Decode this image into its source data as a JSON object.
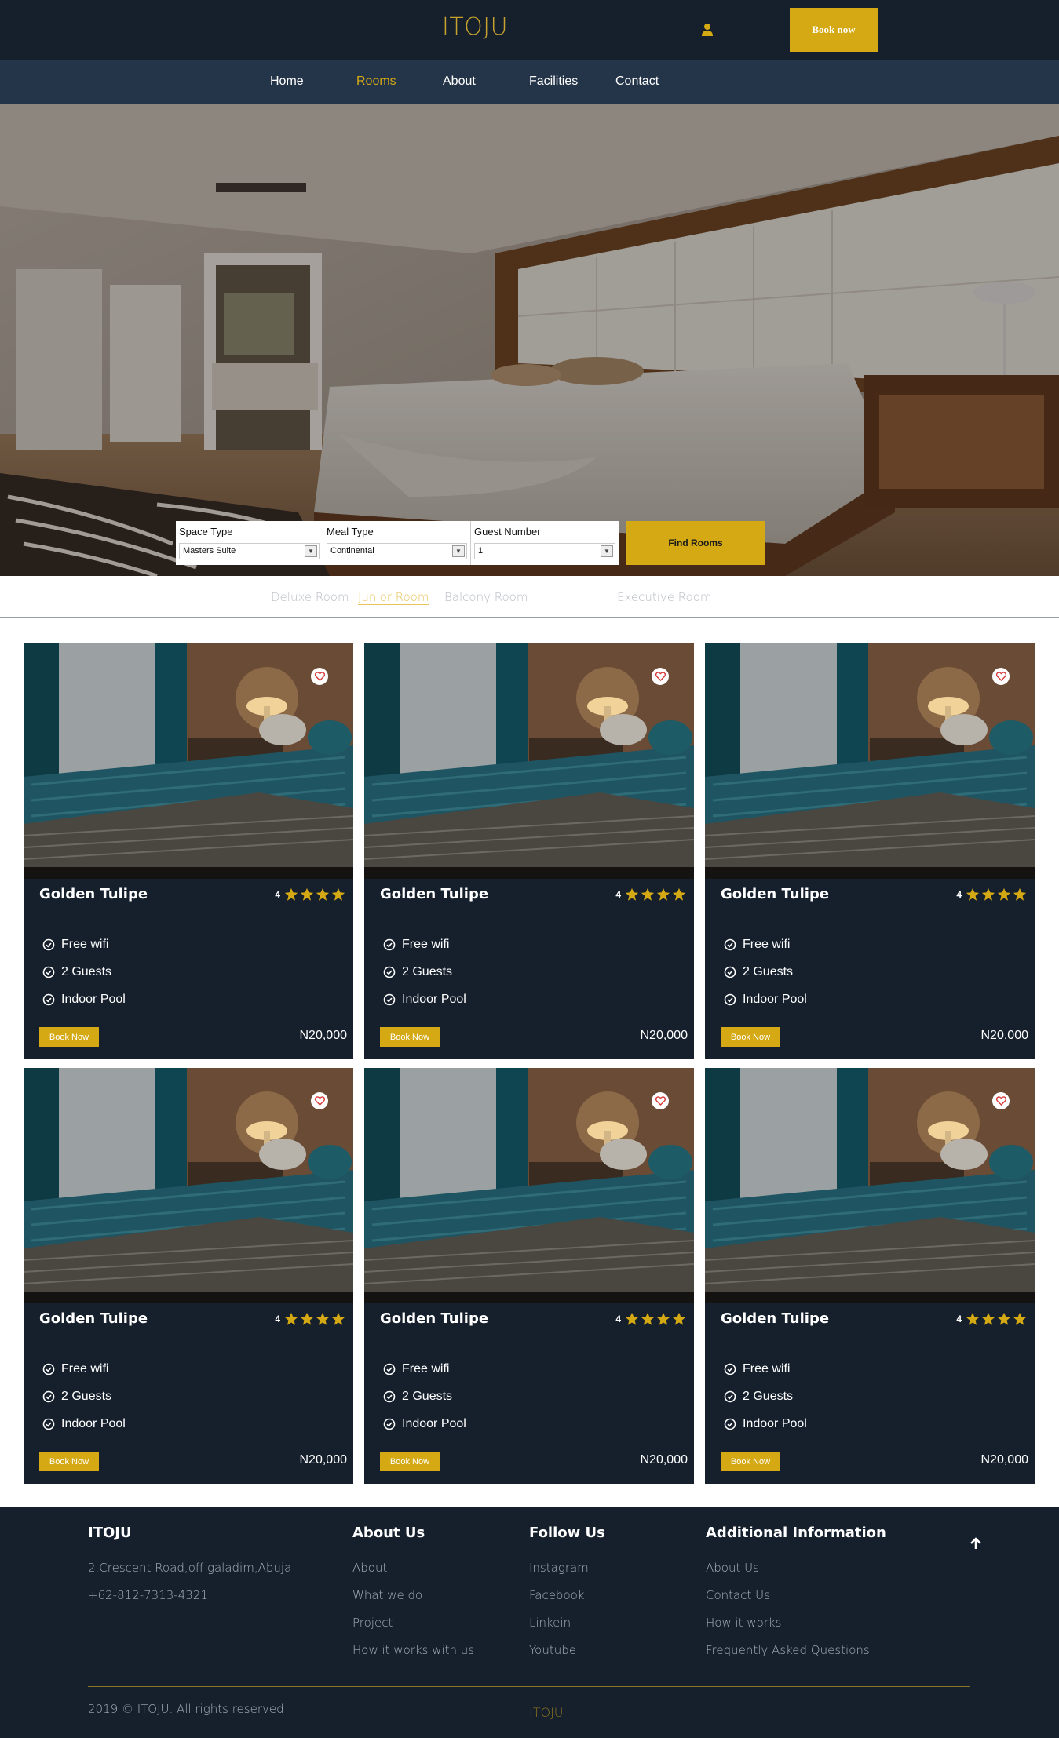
{
  "header": {
    "logo": "ITOJU",
    "book_label": "Book now"
  },
  "nav": [
    {
      "label": "Home",
      "active": false
    },
    {
      "label": "Rooms",
      "active": true
    },
    {
      "label": "About",
      "active": false
    },
    {
      "label": "Facilities",
      "active": false
    },
    {
      "label": "Contact",
      "active": false
    }
  ],
  "search": {
    "space_type": {
      "label": "Space Type",
      "value": "Masters Suite"
    },
    "meal_type": {
      "label": "Meal Type",
      "value": "Continental"
    },
    "guest_number": {
      "label": "Guest Number",
      "value": "1"
    },
    "find_label": "Find Rooms"
  },
  "tabs": [
    {
      "label": "Deluxe Room",
      "active": false
    },
    {
      "label": "Junior Room",
      "active": true
    },
    {
      "label": "Balcony Room",
      "active": false
    },
    {
      "label": "Executive Room",
      "active": false
    }
  ],
  "rooms": [
    {
      "title": "Golden Tulipe",
      "rating": "4",
      "features": [
        "Free wifi",
        "2 Guests",
        "Indoor Pool"
      ],
      "book_label": "Book Now",
      "price": "N20,000"
    },
    {
      "title": "Golden Tulipe",
      "rating": "4",
      "features": [
        "Free wifi",
        "2 Guests",
        "Indoor Pool"
      ],
      "book_label": "Book Now",
      "price": "N20,000"
    },
    {
      "title": "Golden Tulipe",
      "rating": "4",
      "features": [
        "Free wifi",
        "2 Guests",
        "Indoor Pool"
      ],
      "book_label": "Book Now",
      "price": "N20,000"
    },
    {
      "title": "Golden Tulipe",
      "rating": "4",
      "features": [
        "Free wifi",
        "2 Guests",
        "Indoor Pool"
      ],
      "book_label": "Book Now",
      "price": "N20,000"
    },
    {
      "title": "Golden Tulipe",
      "rating": "4",
      "features": [
        "Free wifi",
        "2 Guests",
        "Indoor Pool"
      ],
      "book_label": "Book Now",
      "price": "N20,000"
    },
    {
      "title": "Golden Tulipe",
      "rating": "4",
      "features": [
        "Free wifi",
        "2 Guests",
        "Indoor Pool"
      ],
      "book_label": "Book Now",
      "price": "N20,000"
    }
  ],
  "footer": {
    "brand": {
      "title": "ITOJU",
      "address": "2,Crescent Road,off galadim,Abuja",
      "phone": "+62-812-7313-4321"
    },
    "about": {
      "title": "About Us",
      "links": [
        "About",
        "What we do",
        "Project",
        "How it works with us"
      ]
    },
    "follow": {
      "title": "Follow Us",
      "links": [
        "Instagram",
        "Facebook",
        "Linkein",
        "Youtube"
      ]
    },
    "additional": {
      "title": "Additional Information",
      "links": [
        "About Us",
        "Contact Us",
        "How it works",
        "Frequently Asked Questions"
      ]
    },
    "copyright": "2019 © ITOJU. All rights reserved",
    "bottom_brand": "ITOJU"
  },
  "colors": {
    "navy": "#16202d",
    "nav": "#253549",
    "gold": "#d4a914"
  },
  "icons": {
    "user": "user-icon",
    "heart": "heart-icon",
    "star": "star-icon",
    "check": "check-circle-icon",
    "up": "arrow-up-icon"
  }
}
